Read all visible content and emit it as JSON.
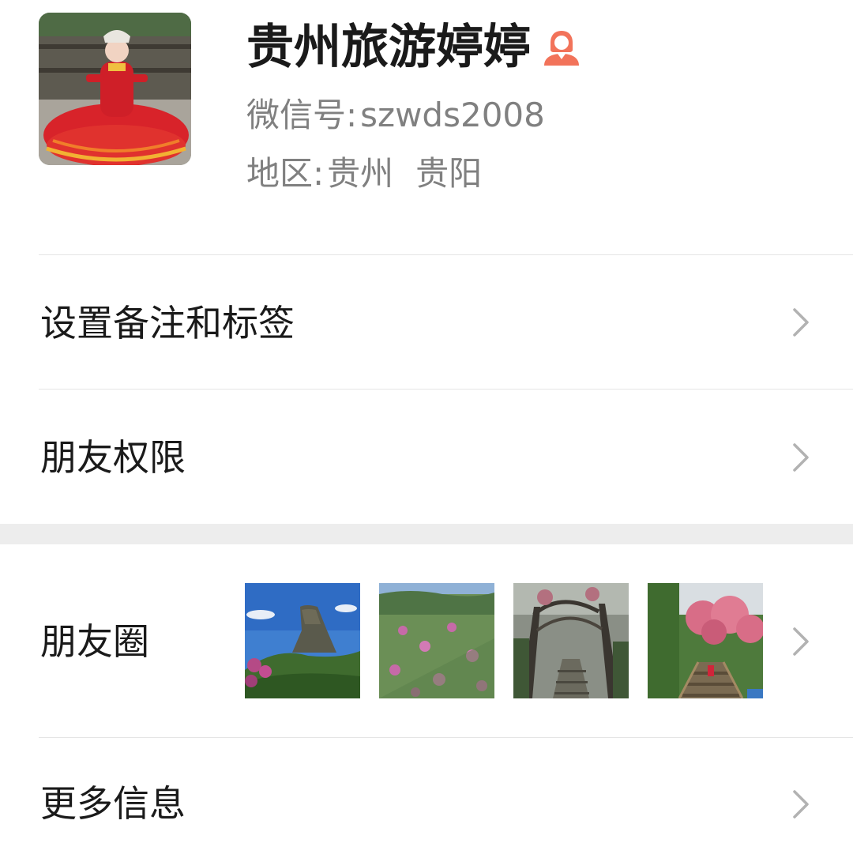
{
  "profile": {
    "display_name": "贵州旅游婷婷",
    "gender_icon": "female-icon",
    "wechat_id_label": "微信号:",
    "wechat_id": "szwds2008",
    "region_label": "地区:",
    "region_province": "贵州",
    "region_city": "贵阳",
    "avatar_icon": "avatar-photo"
  },
  "cells": {
    "remark_tags": "设置备注和标签",
    "friend_permissions": "朋友权限",
    "moments": "朋友圈",
    "more_info": "更多信息"
  },
  "moments_thumbnails": [
    "moments-photo-mountain",
    "moments-photo-hillside-flowers",
    "moments-photo-forest-path",
    "moments-photo-flower-stairs"
  ],
  "colors": {
    "gender_icon": "#F2735A",
    "chevron": "#B2B2B2",
    "divider": "#E5E5E5",
    "section_gap": "#EDEDED"
  }
}
